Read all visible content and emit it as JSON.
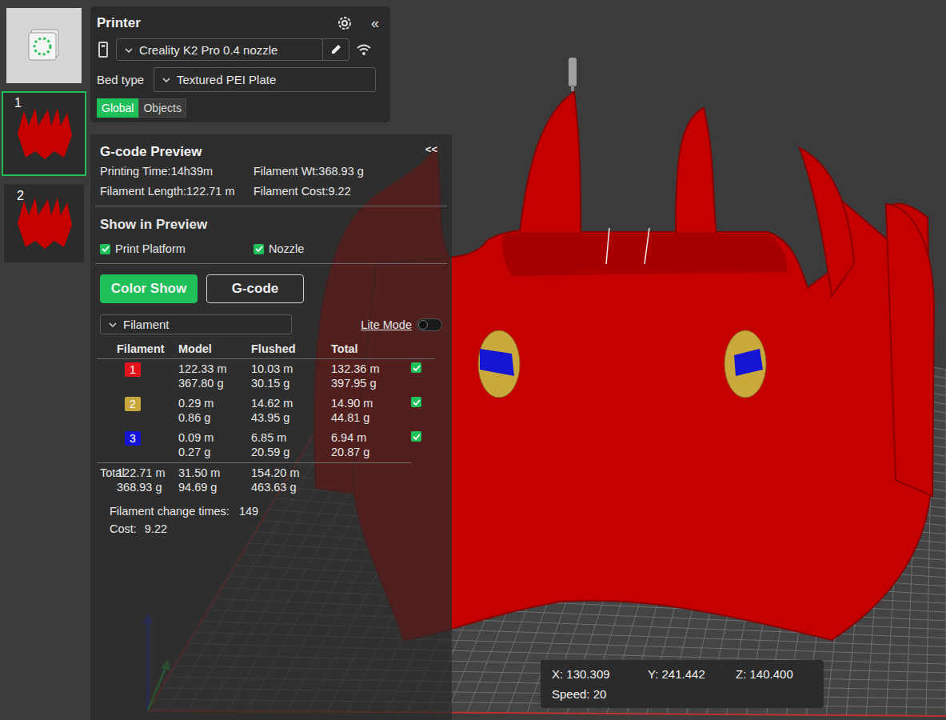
{
  "plates": [
    {
      "label": "1",
      "selected": true
    },
    {
      "label": "2",
      "selected": false
    }
  ],
  "printer": {
    "title": "Printer",
    "collapse": "«",
    "printer_name": "Creality K2 Pro 0.4 nozzle",
    "bed_type_label": "Bed type",
    "bed_type": "Textured PEI Plate",
    "tabs": [
      {
        "label": "Global",
        "selected": true
      },
      {
        "label": "Objects",
        "selected": false
      }
    ]
  },
  "gcode_preview": {
    "title": "G-code Preview",
    "collapse": "<<",
    "stats": [
      "Printing Time:14h39m",
      "Filament Wt:368.93 g",
      "Filament Length:122.71 m",
      "Filament Cost:9.22"
    ]
  },
  "show_in_preview": {
    "title": "Show in Preview",
    "options": [
      {
        "label": "Print Platform",
        "checked": true
      },
      {
        "label": "Nozzle",
        "checked": true
      }
    ]
  },
  "view_buttons": [
    {
      "label": "Color Show",
      "selected": true
    },
    {
      "label": "G-code",
      "selected": false
    }
  ],
  "view_type": "Filament",
  "lite_mode": {
    "label": "Lite Mode",
    "on": false
  },
  "table": {
    "columns": [
      "Filament",
      "Model",
      "Flushed",
      "Total"
    ],
    "rows": [
      {
        "label": "1",
        "color": "#e3131b",
        "model": [
          "122.33 m",
          "367.80 g"
        ],
        "flushed": [
          "10.03 m",
          "30.15 g"
        ],
        "total": [
          "132.36 m",
          "397.95 g"
        ],
        "visible": true
      },
      {
        "label": "2",
        "color": "#c8a83c",
        "model": [
          "0.29 m",
          "0.86 g"
        ],
        "flushed": [
          "14.62 m",
          "43.95 g"
        ],
        "total": [
          "14.90 m",
          "44.81 g"
        ],
        "visible": true
      },
      {
        "label": "3",
        "color": "#1414d2",
        "model": [
          "0.09 m",
          "0.27 g"
        ],
        "flushed": [
          "6.85 m",
          "20.59 g"
        ],
        "total": [
          "6.94 m",
          "20.87 g"
        ],
        "visible": true
      }
    ],
    "total": {
      "label": "Total",
      "model": [
        "122.71 m",
        "368.93 g"
      ],
      "flushed": [
        "31.50 m",
        "94.69 g"
      ],
      "total": [
        "154.20 m",
        "463.63 g"
      ]
    }
  },
  "filament_change": {
    "label": "Filament change times:",
    "value": "149"
  },
  "cost": {
    "label": "Cost:",
    "value": "9.22"
  },
  "coords": {
    "x": "X: 130.309",
    "y": "Y: 241.442",
    "z": "Z: 140.400",
    "speed": "Speed: 20"
  }
}
